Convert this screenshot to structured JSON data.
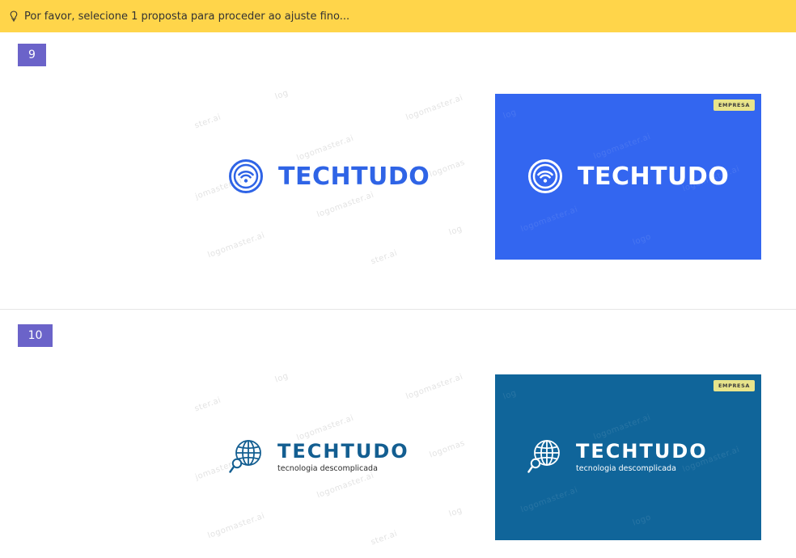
{
  "banner": {
    "message": "Por favor, selecione 1 proposta para proceder ao ajuste fino...",
    "bg": "#ffd54a",
    "icon": "lightbulb-icon"
  },
  "proposals": [
    {
      "number": "9",
      "brand": "TECHTUDO",
      "icon": "wifi-circle-icon",
      "brand_color": "#2f64e6",
      "card_bg": "#3366f0",
      "card_badge": "EMPRESA"
    },
    {
      "number": "10",
      "brand": "TECHTUDO",
      "tagline": "tecnologia descomplicada",
      "icon": "globe-magnifier-icon",
      "brand_color": "#135e91",
      "card_bg": "#10659a",
      "card_badge": "EMPRESA"
    }
  ],
  "watermark": "logomaster.ai",
  "watermark_fragments": {
    "a": "ster.ai",
    "b": "jomaster.ai",
    "c": "logomas",
    "d": "log",
    "e": "ster.ai",
    "f": "logo"
  }
}
